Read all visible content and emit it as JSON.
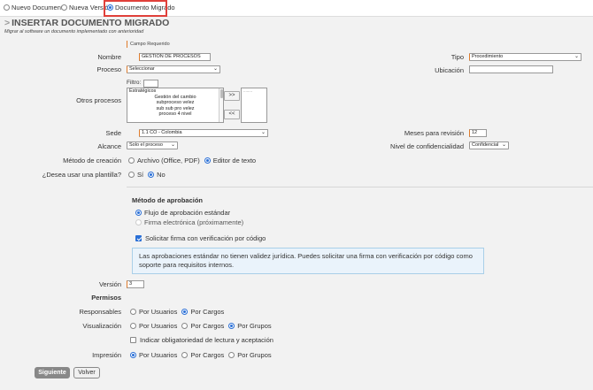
{
  "top_options": [
    {
      "label": "Nuevo Documento",
      "selected": false
    },
    {
      "label": "Nueva Versión",
      "selected": false
    },
    {
      "label": "Documento Migrado",
      "selected": true
    }
  ],
  "header": {
    "arrow": ">",
    "title": "INSERTAR DOCUMENTO MIGRADO",
    "subtitle": "Migrar al software un documento implementado con anterioridad",
    "required_note": "Campo Requerido"
  },
  "form": {
    "nombre": {
      "label": "Nombre",
      "value": "GESTION DE PROCESOS"
    },
    "tipo": {
      "label": "Tipo",
      "value": "Procedimiento"
    },
    "proceso": {
      "label": "Proceso",
      "value": "Seleccionar"
    },
    "ubicacion": {
      "label": "Ubicación",
      "value": ""
    },
    "filtro": {
      "label": "Filtro:",
      "value": ""
    },
    "otros_procesos": {
      "label": "Otros procesos",
      "items": [
        "Estratégicos",
        "Gestión del cambio",
        "subproceso velez",
        "sub sub pro velez",
        "proceso 4 nivel"
      ],
      "selected_items": [
        "........"
      ],
      "add_button": ">>",
      "remove_button": "<<"
    },
    "sede": {
      "label": "Sede",
      "value": "1.1 CO - Colombia"
    },
    "meses_revision": {
      "label": "Meses para revisión",
      "value": "12"
    },
    "alcance": {
      "label": "Alcance",
      "value": "Solo el proceso"
    },
    "confidencialidad": {
      "label": "Nivel de confidencialidad",
      "value": "Confidencial"
    },
    "metodo_creacion": {
      "label": "Método de creación",
      "options": [
        "Archivo (Office, PDF)",
        "Editor de texto"
      ],
      "selected": 1
    },
    "plantilla": {
      "label": "¿Desea usar una plantilla?",
      "options": [
        "Sí",
        "No"
      ],
      "selected": 1
    }
  },
  "aprobacion": {
    "title": "Método de aprobación",
    "options": [
      "Flujo de aprobación estándar",
      "Firma electrónica (próximamente)"
    ],
    "selected": 0,
    "checkbox_label": "Solicitar firma con verificación por código",
    "checkbox_checked": true,
    "info_text": "Las aprobaciones estándar no tienen validez jurídica. Puedes solicitar una firma con verificación por código como soporte para requisitos internos."
  },
  "version": {
    "label": "Versión",
    "value": "3"
  },
  "permisos": {
    "title": "Permisos",
    "responsables": {
      "label": "Responsables",
      "options": [
        "Por Usuarios",
        "Por Cargos"
      ],
      "selected": 1
    },
    "visualizacion": {
      "label": "Visualización",
      "options": [
        "Por Usuarios",
        "Por Cargos",
        "Por Grupos"
      ],
      "selected": 2
    },
    "lectura_label": "Indicar obligatoriedad de lectura y aceptación",
    "impresion": {
      "label": "Impresión",
      "options": [
        "Por Usuarios",
        "Por Cargos",
        "Por Grupos"
      ],
      "selected": 0
    }
  },
  "buttons": {
    "next": "Siguiente",
    "back": "Volver"
  },
  "colors": {
    "accent": "#2a6fd6",
    "required": "#e07b2a",
    "highlight": "#e0403a",
    "info_bg": "#eaf3fb"
  }
}
